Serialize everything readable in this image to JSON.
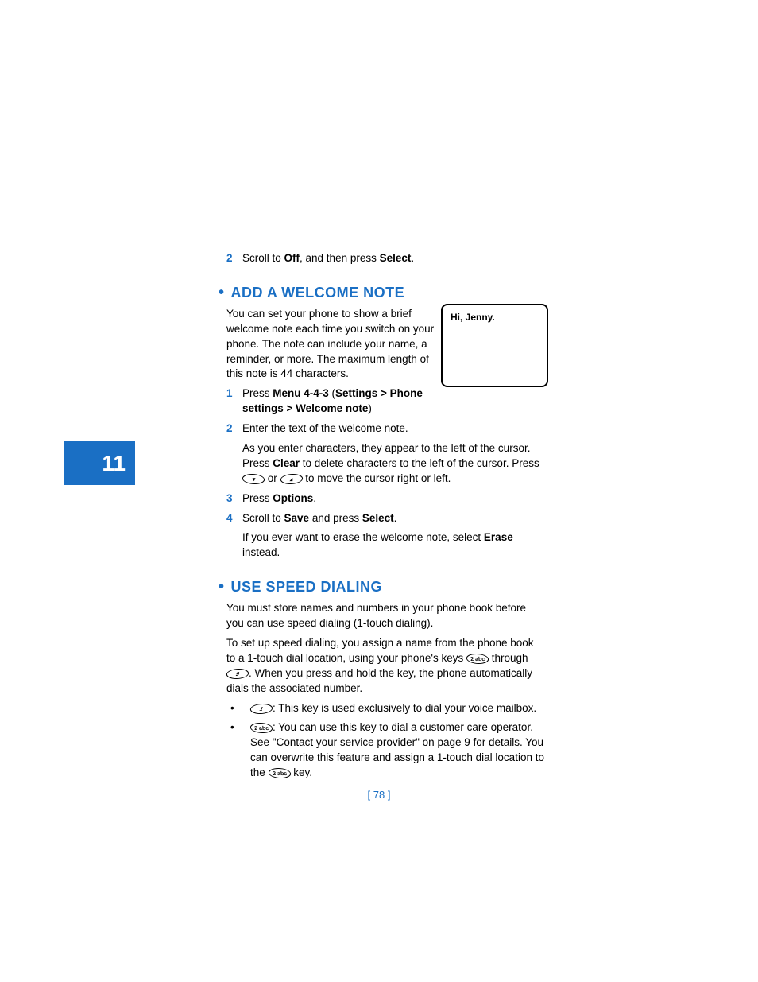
{
  "chapter": "11",
  "pageNumber": "[ 78 ]",
  "screenText": "Hi, Jenny.",
  "topStep": {
    "num": "2",
    "pre": "Scroll to ",
    "b1": "Off",
    "mid": ", and then press ",
    "b2": "Select",
    "post": "."
  },
  "sectionA": {
    "title": "ADD A WELCOME NOTE",
    "intro": "You can set your phone to show a brief welcome note each time you switch on your phone. The note can include your name, a reminder, or more. The maximum length of this note is 44 characters.",
    "step1": {
      "num": "1",
      "pre": "Press ",
      "b1": "Menu 4-4-3",
      "mid1": " (",
      "b2": "Settings > Phone settings > Welcome note",
      "post": ")"
    },
    "step2": {
      "num": "2",
      "text": "Enter the text of the welcome note."
    },
    "step2sub_pre": "As you enter characters, they appear to the left of the cursor. Press ",
    "step2sub_b1": "Clear",
    "step2sub_mid": " to delete characters to the left of the cursor. Press ",
    "step2sub_or": " or ",
    "step2sub_post": " to move the cursor right or left.",
    "step3": {
      "num": "3",
      "pre": "Press ",
      "b1": "Options",
      "post": "."
    },
    "step4": {
      "num": "4",
      "pre": "Scroll to ",
      "b1": "Save",
      "mid": " and press ",
      "b2": "Select",
      "post": "."
    },
    "step4sub_pre": "If you ever want to erase the welcome note, select ",
    "step4sub_b1": "Erase",
    "step4sub_post": " instead."
  },
  "sectionB": {
    "title": "USE SPEED DIALING",
    "p1": "You must store names and numbers in your phone book before you can use speed dialing (1-touch dialing).",
    "p2_pre": "To set up speed dialing, you assign a name from the phone book to a 1-touch dial location, using your phone's keys ",
    "p2_mid": " through ",
    "p2_post": ". When you press and hold the key, the phone automatically dials the associated number.",
    "bul1_post": ": This key is used exclusively to dial your voice mailbox.",
    "bul2_a": ": You can use this key to dial a customer care operator. See \"Contact your service provider\" on page 9 for details. You can overwrite this feature and assign a 1-touch dial location to the ",
    "bul2_b": " key."
  },
  "keys": {
    "k2": "2 abc",
    "k9": "9",
    "k1": "1"
  }
}
